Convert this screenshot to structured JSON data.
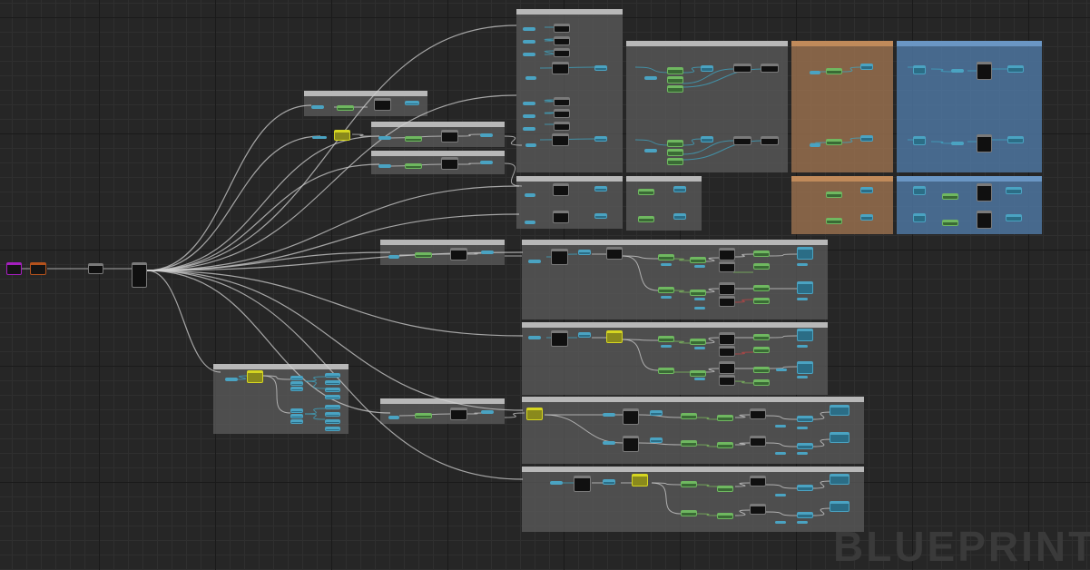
{
  "watermark": "BLUEPRINT",
  "colors": {
    "background": "#262626",
    "comment_gray": "#4f4f4f",
    "comment_orange": "#8a6a48",
    "comment_blue": "#4a6e93",
    "wire_exec": "#d0d0d0",
    "wire_data": "#3fa7c4",
    "wire_green": "#7fbf5f",
    "wire_red": "#c04444",
    "node_dark": "#101010",
    "node_teal": "#2b6d86",
    "node_green": "#3a6a35",
    "node_yellow": "#8a8a1c",
    "node_purple": "#a51fbf",
    "node_orange": "#b5521c"
  },
  "comments": [
    {
      "id": "c_top_left",
      "title": "",
      "color": "gray"
    },
    {
      "id": "c_mid_a",
      "title": "",
      "color": "gray"
    },
    {
      "id": "c_mid_b",
      "title": "",
      "color": "gray"
    },
    {
      "id": "c_big_top",
      "title": "",
      "color": "gray"
    },
    {
      "id": "c_calc",
      "title": "",
      "color": "gray"
    },
    {
      "id": "c_orange_1",
      "title": "",
      "color": "orange"
    },
    {
      "id": "c_blue_1",
      "title": "",
      "color": "blue"
    },
    {
      "id": "c_small_1",
      "title": "",
      "color": "gray"
    },
    {
      "id": "c_small_2",
      "title": "",
      "color": "gray"
    },
    {
      "id": "c_orange_2",
      "title": "",
      "color": "orange"
    },
    {
      "id": "c_blue_2",
      "title": "",
      "color": "blue"
    },
    {
      "id": "c_row2_head",
      "title": "",
      "color": "gray"
    },
    {
      "id": "c_row2_a",
      "title": "",
      "color": "gray"
    },
    {
      "id": "c_row2_b",
      "title": "",
      "color": "gray"
    },
    {
      "id": "c_left_low",
      "title": "",
      "color": "gray"
    },
    {
      "id": "c_row3_head",
      "title": "",
      "color": "gray"
    },
    {
      "id": "c_row3_a",
      "title": "",
      "color": "gray"
    },
    {
      "id": "c_row3_b",
      "title": "",
      "color": "gray"
    }
  ]
}
